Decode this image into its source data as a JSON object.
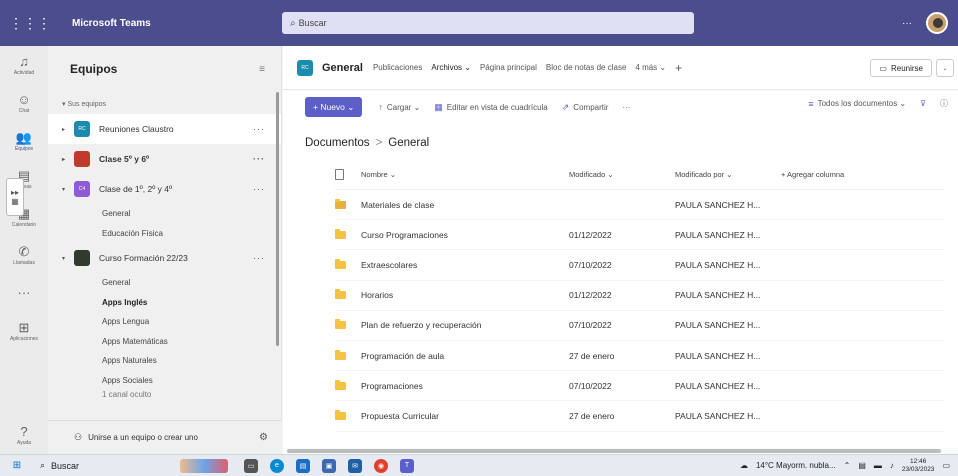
{
  "topbar": {
    "waffle_icon": "⋮⋮⋮",
    "app_title": "Microsoft Teams",
    "search_placeholder": "Buscar",
    "more": "···"
  },
  "rail": [
    {
      "icon": "♫",
      "label": "Actividad"
    },
    {
      "icon": "☺",
      "label": "Chat"
    },
    {
      "icon": "👥",
      "label": "Equipos",
      "active": true
    },
    {
      "icon": "▤",
      "label": "Tareas"
    },
    {
      "icon": "▦",
      "label": "Calendario"
    },
    {
      "icon": "✆",
      "label": "Llamadas"
    },
    {
      "icon": "···",
      "label": ""
    },
    {
      "icon": "⊞",
      "label": "Aplicaciones"
    }
  ],
  "rail_help": {
    "icon": "?",
    "label": "Ayuda"
  },
  "teams_pane": {
    "title": "Equipos",
    "section": "Sus equipos",
    "teams": [
      {
        "name": "Reuniones Claustro",
        "initials": "RC",
        "color": "#1c8bad",
        "selected": true,
        "bold": false,
        "expanded": false
      },
      {
        "name": "Clase 5º y 6º",
        "initials": "",
        "color": "#c0392b",
        "selected": false,
        "bold": true,
        "expanded": false
      },
      {
        "name": "Clase de 1º, 2º y 4º",
        "initials": "C4",
        "color": "#8e5bd6",
        "selected": false,
        "bold": false,
        "expanded": true,
        "channels": [
          {
            "name": "General",
            "bold": false
          },
          {
            "name": "Educación Física",
            "bold": false
          }
        ]
      },
      {
        "name": "Curso Formación 22/23",
        "initials": "",
        "color": "#2e3b2e",
        "selected": false,
        "bold": false,
        "expanded": true,
        "channels": [
          {
            "name": "General",
            "bold": false
          },
          {
            "name": "Apps Inglés",
            "bold": true
          },
          {
            "name": "Apps Lengua",
            "bold": false
          },
          {
            "name": "Apps Matemáticas",
            "bold": false
          },
          {
            "name": "Apps Naturales",
            "bold": false
          },
          {
            "name": "Apps Sociales",
            "bold": false
          },
          {
            "name": "1 canal oculto",
            "bold": false
          }
        ]
      }
    ],
    "footer": "Unirse a un equipo o crear uno"
  },
  "channel_header": {
    "badge": "RC",
    "title": "General",
    "tabs": [
      "Publicaciones",
      "Archivos ⌄",
      "Página principal",
      "Bloc de notas de clase",
      "4 más ⌄",
      "+"
    ],
    "active_tab": 1,
    "meet": "Reunirse"
  },
  "toolbar": {
    "new": "+ Nuevo ⌄",
    "upload": "Cargar ⌄",
    "grid": "Editar en vista de cuadrícula",
    "share": "Compartir",
    "more": "···",
    "all_docs": "Todos los documentos ⌄"
  },
  "breadcrumb": {
    "root": "Documentos",
    "sep": ">",
    "current": "General"
  },
  "files": {
    "headers": {
      "name": "Nombre ⌄",
      "modified": "Modificado ⌄",
      "modified_by": "Modificado por ⌄",
      "add_column": "+ Agregar columna"
    },
    "rows": [
      {
        "name": "Materiales de clase",
        "modified": "",
        "by": "PAULA SANCHEZ H...",
        "shared": true
      },
      {
        "name": "Curso Programaciones",
        "modified": "01/12/2022",
        "by": "PAULA SANCHEZ H...",
        "shared": false
      },
      {
        "name": "Extraescolares",
        "modified": "07/10/2022",
        "by": "PAULA SANCHEZ H...",
        "shared": false
      },
      {
        "name": "Horarios",
        "modified": "01/12/2022",
        "by": "PAULA SANCHEZ H...",
        "shared": false
      },
      {
        "name": "Plan de refuerzo y recuperación",
        "modified": "07/10/2022",
        "by": "PAULA SANCHEZ H...",
        "shared": false
      },
      {
        "name": "Programación de aula",
        "modified": "27 de enero",
        "by": "PAULA SANCHEZ H...",
        "shared": false
      },
      {
        "name": "Programaciones",
        "modified": "07/10/2022",
        "by": "PAULA SANCHEZ H...",
        "shared": false
      },
      {
        "name": "Propuesta Curricular",
        "modified": "27 de enero",
        "by": "PAULA SANCHEZ H...",
        "shared": false
      }
    ]
  },
  "taskbar": {
    "search": "Buscar",
    "weather": "14°C  Mayorm. nubla...",
    "time": "12:46",
    "date": "23/03/2023"
  }
}
